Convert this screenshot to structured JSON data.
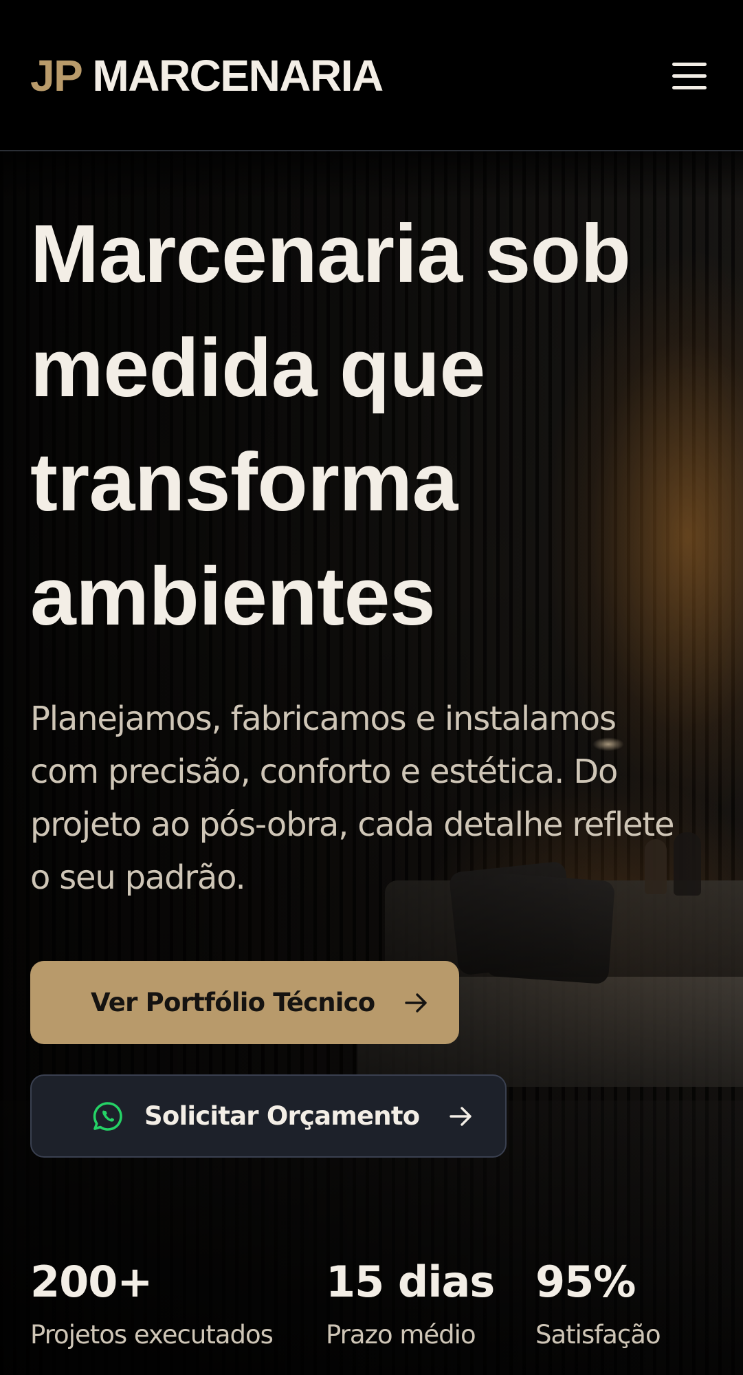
{
  "header": {
    "logo_accent": "JP",
    "logo_main": "MARCENARIA",
    "menu_icon": "hamburger-menu-icon"
  },
  "hero": {
    "headline": "Marcenaria sob medida que transforma ambientes",
    "subtitle": "Planejamos, fabricamos e instalamos com precisão, conforto e estética. Do projeto ao pós-obra, cada detalhe reflete o seu padrão.",
    "primary_button": {
      "label": "Ver Portfólio Técnico",
      "icon": "arrow-right-icon"
    },
    "secondary_button": {
      "label": "Solicitar Orçamento",
      "leading_icon": "whatsapp-icon",
      "icon": "arrow-right-icon"
    }
  },
  "stats": [
    {
      "value": "200+",
      "label": "Projetos executados"
    },
    {
      "value": "15 dias",
      "label": "Prazo médio"
    },
    {
      "value": "95%",
      "label": "Satisfação"
    }
  ],
  "colors": {
    "accent": "#b99b6b",
    "text_light": "#f3eee6",
    "text_muted": "#cfc6b7",
    "secondary_button_bg": "#1d212a",
    "whatsapp_green": "#25d366"
  }
}
